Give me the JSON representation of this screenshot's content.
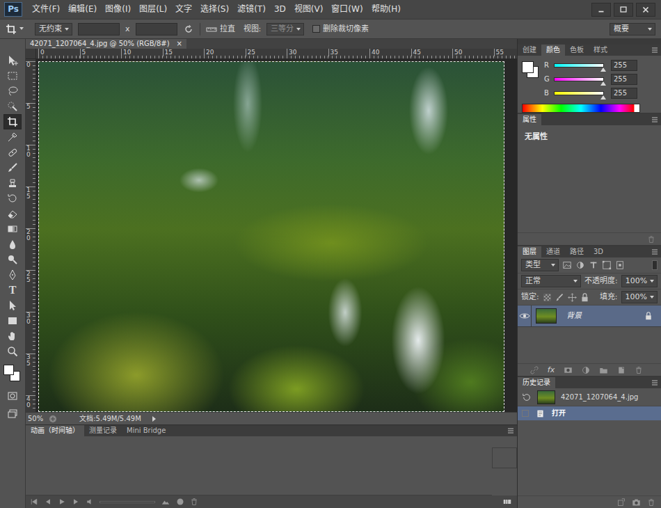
{
  "app": {
    "logo": "Ps"
  },
  "menu": [
    "文件(F)",
    "编辑(E)",
    "图像(I)",
    "图层(L)",
    "文字",
    "选择(S)",
    "滤镜(T)",
    "3D",
    "视图(V)",
    "窗口(W)",
    "帮助(H)"
  ],
  "options_bar": {
    "ratio": "无约束",
    "width": "",
    "height": "",
    "times": "x",
    "straighten": "拉直",
    "view_label": "视图:",
    "view": {
      "value": "三等分",
      "disabled": true
    },
    "delete_cropped": {
      "label": "删除裁切像素",
      "checked": false
    },
    "workspace": "概要"
  },
  "tools": [
    {
      "kind": "move",
      "selected": false
    },
    {
      "kind": "marquee",
      "selected": false
    },
    {
      "kind": "lasso",
      "selected": false
    },
    {
      "kind": "quick-select",
      "selected": false
    },
    {
      "kind": "crop",
      "selected": true
    },
    {
      "kind": "eyedropper",
      "selected": false
    },
    {
      "kind": "healing",
      "selected": false
    },
    {
      "kind": "brush",
      "selected": false
    },
    {
      "kind": "stamp",
      "selected": false
    },
    {
      "kind": "history-brush",
      "selected": false
    },
    {
      "kind": "eraser",
      "selected": false
    },
    {
      "kind": "gradient",
      "selected": false
    },
    {
      "kind": "blur",
      "selected": false
    },
    {
      "kind": "dodge",
      "selected": false
    },
    {
      "kind": "pen",
      "selected": false
    },
    {
      "kind": "type",
      "glyph": "T",
      "selected": false
    },
    {
      "kind": "path-select",
      "selected": false
    },
    {
      "kind": "shape",
      "selected": false
    },
    {
      "kind": "hand",
      "selected": false
    },
    {
      "kind": "zoom",
      "selected": false
    }
  ],
  "swatches": {
    "foreground": "#ffffff",
    "background": "#ffffff"
  },
  "document": {
    "tab": "42071_1207064_4.jpg @ 50% (RGB/8#)",
    "close": "×",
    "ruler_top": [
      "0",
      "5",
      "10",
      "15",
      "20",
      "25",
      "30",
      "35",
      "40",
      "45",
      "50",
      "55"
    ],
    "ruler_left": [
      "0",
      "5",
      "10",
      "15",
      "20",
      "25",
      "30",
      "35",
      "40"
    ],
    "zoom": "50%",
    "doc_size": "文档:5.49M/5.49M"
  },
  "bottom_panel": {
    "tabs": [
      {
        "label": "动画（时间轴）",
        "selected": true
      },
      {
        "label": "测量记录",
        "selected": false
      },
      {
        "label": "Mini Bridge",
        "selected": false
      }
    ]
  },
  "color_panel": {
    "tabs": [
      {
        "label": "创建",
        "selected": false
      },
      {
        "label": "颜色",
        "selected": true
      },
      {
        "label": "色板",
        "selected": false
      },
      {
        "label": "样式",
        "selected": false
      }
    ],
    "channels": [
      {
        "name": "R",
        "value": "255",
        "level": 1,
        "color": "#00ffff"
      },
      {
        "name": "G",
        "value": "255",
        "level": 1,
        "color": "#ff00ff"
      },
      {
        "name": "B",
        "value": "255",
        "level": 1,
        "color": "#ffff00"
      }
    ]
  },
  "properties": {
    "title": "属性",
    "content": "无属性"
  },
  "layers": {
    "tabs": [
      {
        "label": "图层",
        "selected": true
      },
      {
        "label": "通道",
        "selected": false
      },
      {
        "label": "路径",
        "selected": false
      },
      {
        "label": "3D",
        "selected": false
      }
    ],
    "filter": "类型",
    "blend_mode": "正常",
    "opacity_label": "不透明度:",
    "opacity": "100%",
    "lock_label": "锁定:",
    "fill_label": "填充:",
    "fill": "100%",
    "fx_label": "fx",
    "items": [
      {
        "name": "背景",
        "visible": true,
        "locked": true,
        "selected": true
      }
    ]
  },
  "history": {
    "title": "历史记录",
    "snapshot": "42071_1207064_4.jpg",
    "states": [
      {
        "label": "打开",
        "selected": true
      }
    ]
  }
}
